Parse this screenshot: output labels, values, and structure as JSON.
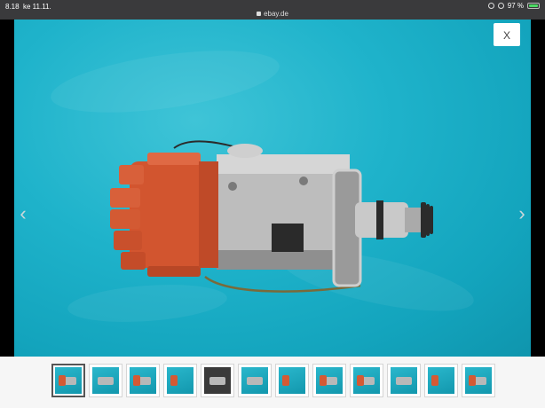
{
  "status_bar": {
    "time": "8.18",
    "date": "ke 11.11.",
    "url": "ebay.de",
    "battery_text": "97 %",
    "battery_level": 0.97,
    "battery_color": "#4cd964",
    "icons": [
      "link-icon",
      "rotation-lock-icon",
      "battery-icon"
    ]
  },
  "viewer": {
    "close_label": "X",
    "prev_arrow": "‹",
    "next_arrow": "›",
    "background_color": "#1fb3cb"
  },
  "thumbnails": {
    "count": 12,
    "selected_index": 0
  }
}
